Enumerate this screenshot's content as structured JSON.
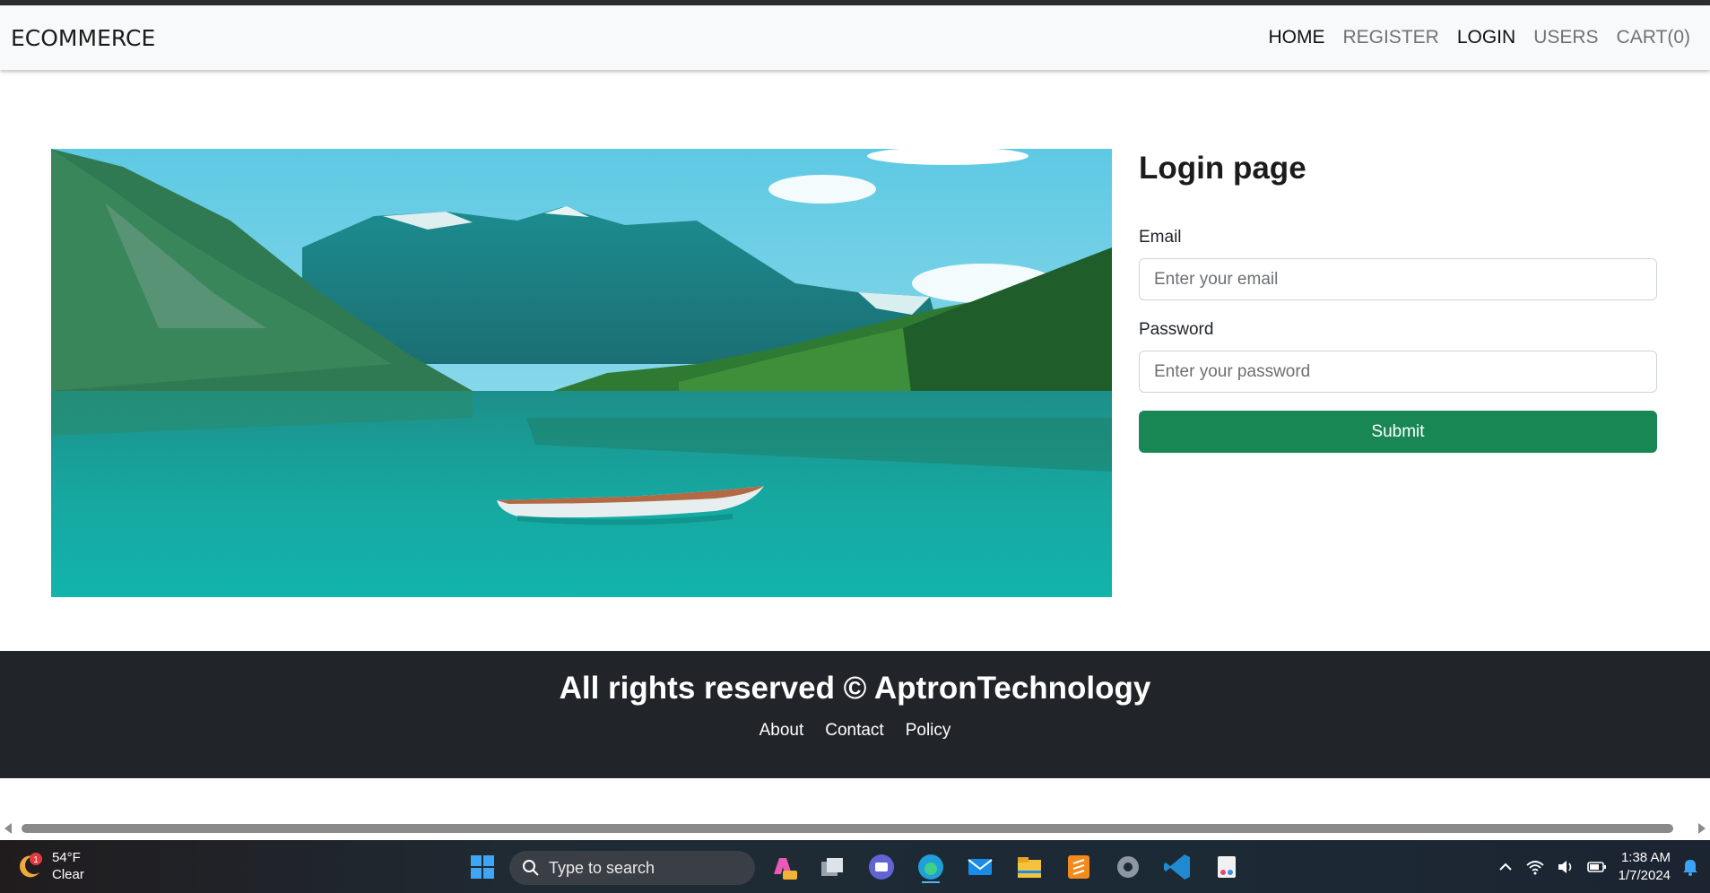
{
  "navbar": {
    "brand": "ECOMMERCE",
    "links": [
      {
        "label": "HOME"
      },
      {
        "label": "REGISTER"
      },
      {
        "label": "LOGIN"
      },
      {
        "label": "USERS"
      },
      {
        "label": "CART(0)"
      }
    ]
  },
  "login": {
    "title": "Login page",
    "email_label": "Email",
    "email_placeholder": "Enter your email",
    "email_value": "",
    "password_label": "Password",
    "password_placeholder": "Enter your password",
    "password_value": "",
    "submit_label": "Submit",
    "submit_color": "#198754"
  },
  "footer": {
    "text": "All rights reserved © AptronTechnology",
    "links": [
      {
        "label": "About"
      },
      {
        "label": "Contact"
      },
      {
        "label": "Policy"
      }
    ]
  },
  "taskbar": {
    "weather_temp": "54°F",
    "weather_desc": "Clear",
    "weather_badge": "1",
    "search_placeholder": "Type to search",
    "time": "1:38 AM",
    "date": "1/7/2024",
    "apps": [
      "windows-start-icon",
      "copilot-icon",
      "task-view-icon",
      "teams-icon",
      "edge-icon",
      "mail-icon",
      "file-explorer-icon",
      "sublime-text-icon",
      "settings-icon",
      "vscode-icon",
      "snipping-tool-icon"
    ]
  }
}
